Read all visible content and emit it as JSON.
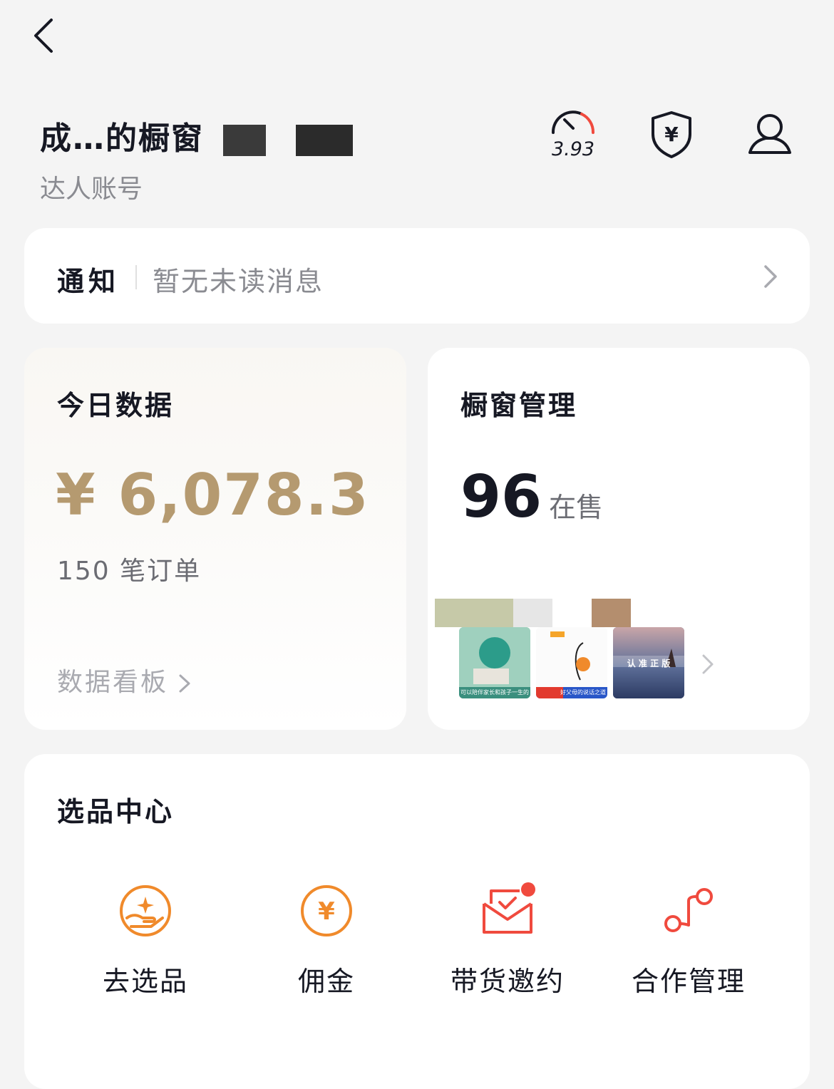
{
  "header": {
    "shop_name": "成…的橱窗",
    "account_type": "达人账号",
    "score": "3.93"
  },
  "notice": {
    "title": "通知",
    "message": "暂无未读消息"
  },
  "today": {
    "title": "今日数据",
    "amount": "¥ 6,078.3",
    "orders": "150 笔订单",
    "board_link": "数据看板"
  },
  "window": {
    "title": "橱窗管理",
    "count": "96",
    "count_label": "在售",
    "thumbs": [
      {
        "caption": "可以陪伴家长和孩子一生的书"
      },
      {
        "caption": "好父母的说话之道"
      },
      {
        "caption": "认 准 正 版"
      }
    ]
  },
  "select_center": {
    "title": "选品中心",
    "tools": [
      {
        "label": "去选品",
        "icon": "hand-star-icon"
      },
      {
        "label": "佣金",
        "icon": "yuan-coin-icon"
      },
      {
        "label": "带货邀约",
        "icon": "envelope-check-icon",
        "badge": true
      },
      {
        "label": "合作管理",
        "icon": "connect-nodes-icon"
      }
    ]
  },
  "colors": {
    "accent": "#f08a2b",
    "red": "#f04a3e",
    "gold": "#b59a70"
  }
}
